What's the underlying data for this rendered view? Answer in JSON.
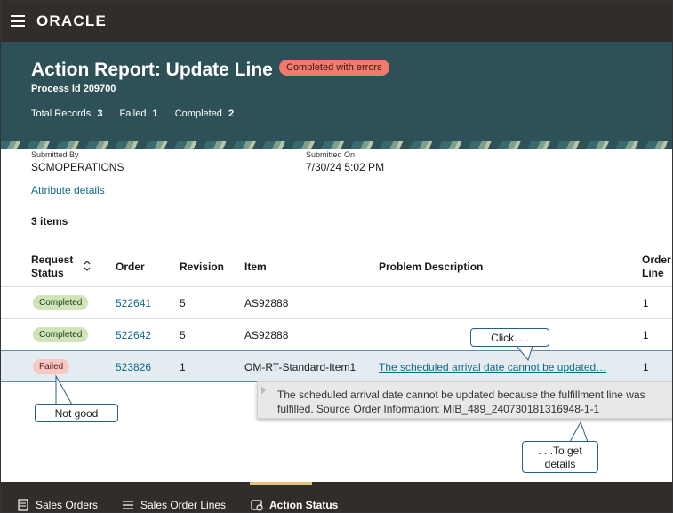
{
  "app": {
    "logo": "ORACLE"
  },
  "header": {
    "title": "Action Report: Update Line",
    "status_badge": "Completed with errors",
    "process_id": "Process Id 209700",
    "stats": {
      "total_label": "Total Records",
      "total_value": "3",
      "failed_label": "Failed",
      "failed_value": "1",
      "completed_label": "Completed",
      "completed_value": "2"
    }
  },
  "submission": {
    "submitted_by_label": "Submitted By",
    "submitted_by_value": "SCMOPERATIONS",
    "submitted_on_label": "Submitted On",
    "submitted_on_value": "7/30/24 5:02 PM",
    "attribute_link": "Attribute details"
  },
  "table": {
    "count_label": "3 items",
    "headers": {
      "status_line1": "Request",
      "status_line2": "Status",
      "order": "Order",
      "revision": "Revision",
      "item": "Item",
      "problem": "Problem Description",
      "order_line_line1": "Order",
      "order_line_line2": "Line"
    },
    "rows": [
      {
        "status": "Completed",
        "order": "522641",
        "revision": "5",
        "item": "AS92888",
        "problem": "",
        "order_line": "1"
      },
      {
        "status": "Completed",
        "order": "522642",
        "revision": "5",
        "item": "AS92888",
        "problem": "",
        "order_line": "1"
      },
      {
        "status": "Failed",
        "order": "523826",
        "revision": "1",
        "item": "OM-RT-Standard-Item1",
        "problem": "The scheduled arrival date cannot be updated…",
        "order_line": "1"
      }
    ]
  },
  "tooltip": {
    "line1": "The scheduled arrival date cannot be updated because the fulfillment line was",
    "line2": "fulfilled. Source Order Information: MIB_489_240730181316948-1-1"
  },
  "callouts": {
    "not_good": "Not good",
    "click": "Click. . .",
    "to_get_line1": ". . .To get",
    "to_get_line2": "details"
  },
  "bottom_nav": {
    "items": [
      {
        "label": "Sales Orders",
        "icon": "document-icon"
      },
      {
        "label": "Sales Order Lines",
        "icon": "list-icon"
      },
      {
        "label": "Action Status",
        "icon": "status-icon"
      }
    ]
  },
  "colors": {
    "nav_bg": "#312d2a",
    "header_bg": "#2e5157",
    "link": "#0f6a88",
    "badge_error": "#f07a6b",
    "status_completed": "#cfe5b8",
    "status_failed": "#f7c9c2"
  }
}
